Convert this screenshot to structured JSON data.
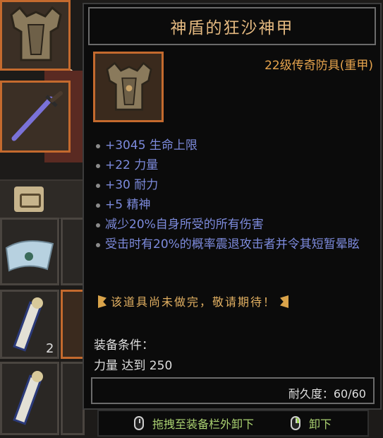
{
  "tooltip": {
    "title": "神盾的狂沙神甲",
    "rarity": "22级传奇防具(重甲)",
    "icon": "armor-icon",
    "stats": [
      "+3045 生命上限",
      "+22 力量",
      "+30 耐力",
      "+5 精神",
      "减少20%自身所受的所有伤害",
      "受击时有20%的概率震退攻击者并令其短暂晕眩"
    ],
    "unfinished_note": "该道具尚未做完，敬请期待！",
    "requirements_header": "装备条件：",
    "requirement": "力量 达到 250",
    "durability": "耐久度：60/60",
    "colors": {
      "title": "#e4b980",
      "rarity": "#e8a54e",
      "stat": "#7d8bdd",
      "note": "#e2b062",
      "action": "#a9d070",
      "frame": "#c46a2e"
    }
  },
  "actions": {
    "drag_unequip": "拖拽至装备栏外卸下",
    "unequip": "卸下"
  },
  "inventory": {
    "scroll_stack_count": "2",
    "slot_icons": [
      "armor-icon",
      "sword-icon",
      "bag-tab-icon",
      "cloth-icon",
      "scroll-icon",
      "scroll-icon"
    ]
  }
}
